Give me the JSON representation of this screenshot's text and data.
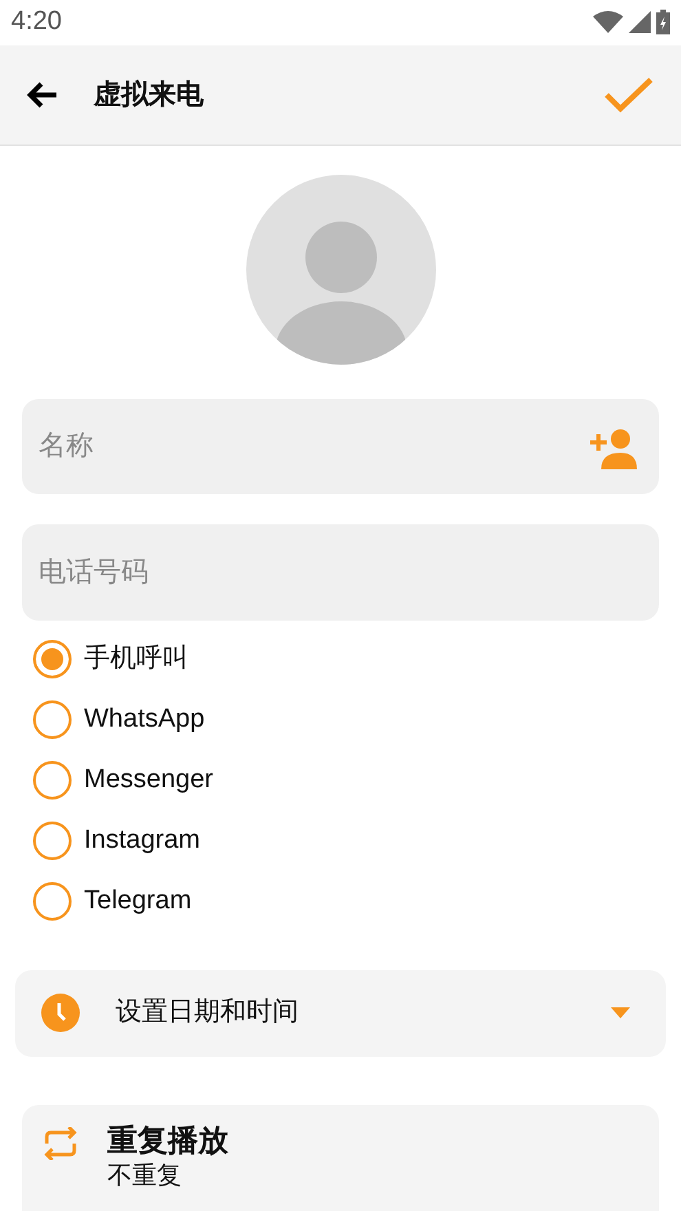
{
  "status_bar": {
    "time": "4:20"
  },
  "app_bar": {
    "title": "虚拟来电"
  },
  "name_field": {
    "placeholder": "名称"
  },
  "phone_field": {
    "placeholder": "电话号码"
  },
  "call_types": [
    {
      "label": "手机呼叫",
      "selected": true
    },
    {
      "label": "WhatsApp",
      "selected": false
    },
    {
      "label": "Messenger",
      "selected": false
    },
    {
      "label": "Instagram",
      "selected": false
    },
    {
      "label": "Telegram",
      "selected": false
    }
  ],
  "date_time": {
    "label": "设置日期和时间"
  },
  "repeat": {
    "title": "重复播放",
    "value": "不重复"
  }
}
